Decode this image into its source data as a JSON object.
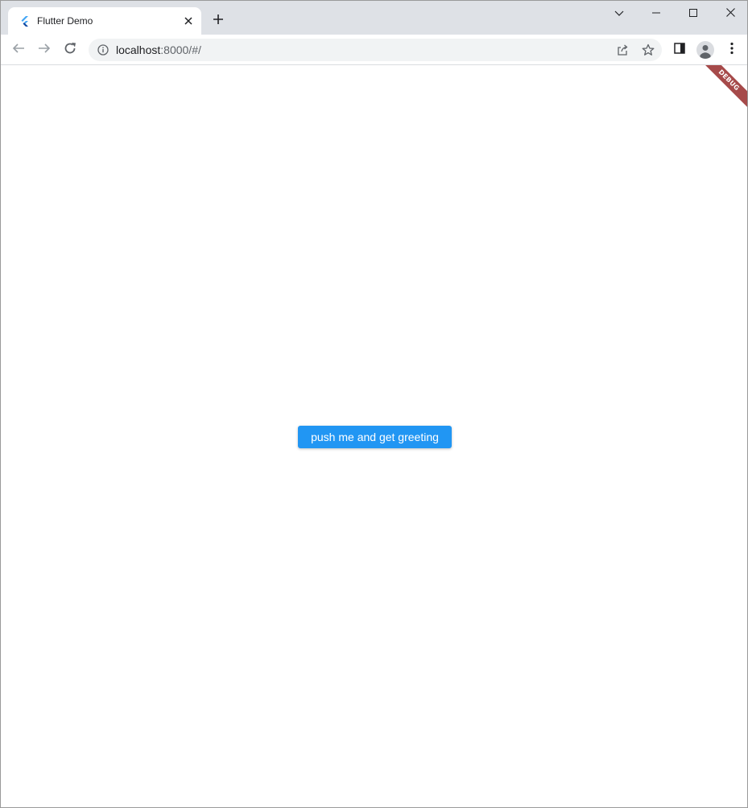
{
  "browser": {
    "tab": {
      "title": "Flutter Demo",
      "favicon": "flutter-logo-icon"
    },
    "address": {
      "host": "localhost",
      "rest": ":8000/#/"
    },
    "icons": {
      "back": "arrow-left-icon",
      "forward": "arrow-right-icon",
      "reload": "reload-icon",
      "info": "info-icon",
      "share": "share-icon",
      "bookmark": "star-icon",
      "side_panel": "side-panel-icon",
      "profile": "profile-icon",
      "menu": "kebab-menu-icon"
    }
  },
  "app": {
    "button_label": "push me and get greeting",
    "debug_banner": "DEBUG",
    "colors": {
      "button": "#2196f3",
      "banner": "#a64a4a"
    }
  }
}
